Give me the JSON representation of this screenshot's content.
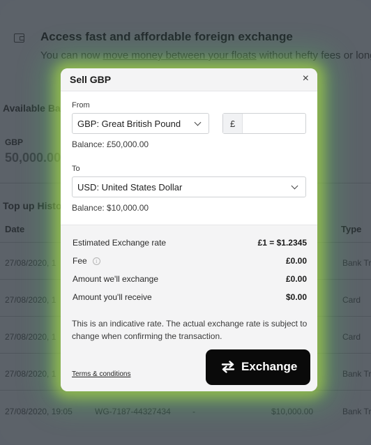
{
  "background": {
    "banner": {
      "title": "Access fast and affordable foreign exchange",
      "subtitle_pre": "You can now ",
      "subtitle_link": "move money between your floats",
      "subtitle_post": " without hefty fees or long w"
    },
    "available": {
      "title": "Available Ba",
      "currency_label": "GBP",
      "amount": "50,000.00"
    },
    "topup": {
      "title": "Top up Histo",
      "columns": {
        "date": "Date",
        "type": "Type"
      },
      "rows": [
        {
          "date": "27/08/2020, 1",
          "type": "Bank Tr"
        },
        {
          "date": "27/08/2020, 1",
          "type": "Card"
        },
        {
          "date": "27/08/2020, 1",
          "type": "Card"
        },
        {
          "date": "27/08/2020, 1",
          "type": "Bank Tr"
        },
        {
          "date": "27/08/2020, 19:05",
          "reference": "WG-7187-44327434",
          "dash": "-",
          "amount": "$10,000.00",
          "type": "Bank Tr"
        }
      ]
    }
  },
  "modal": {
    "title": "Sell GBP",
    "close_glyph": "×",
    "from": {
      "label": "From",
      "selected": "GBP: Great British Pound",
      "currency_symbol": "£",
      "amount_value": "",
      "balance": "Balance: £50,000.00"
    },
    "to": {
      "label": "To",
      "selected": "USD: United States Dollar",
      "balance": "Balance: $10,000.00"
    },
    "summary": {
      "rate_label": "Estimated Exchange rate",
      "rate_value": "£1 = $1.2345",
      "fee_label": "Fee",
      "fee_info_glyph": "i",
      "fee_value": "£0.00",
      "exchange_label": "Amount we'll exchange",
      "exchange_value": "£0.00",
      "receive_label": "Amount you'll receive",
      "receive_value": "$0.00"
    },
    "disclaimer": "This is an indicative rate. The actual exchange rate is subject to change when confirming the transaction.",
    "terms_link": "Terms & conditions",
    "exchange_button": "Exchange"
  },
  "colors": {
    "overlay": "#5c6269",
    "button": "#0a0a0a",
    "glow": "#bee63c"
  }
}
